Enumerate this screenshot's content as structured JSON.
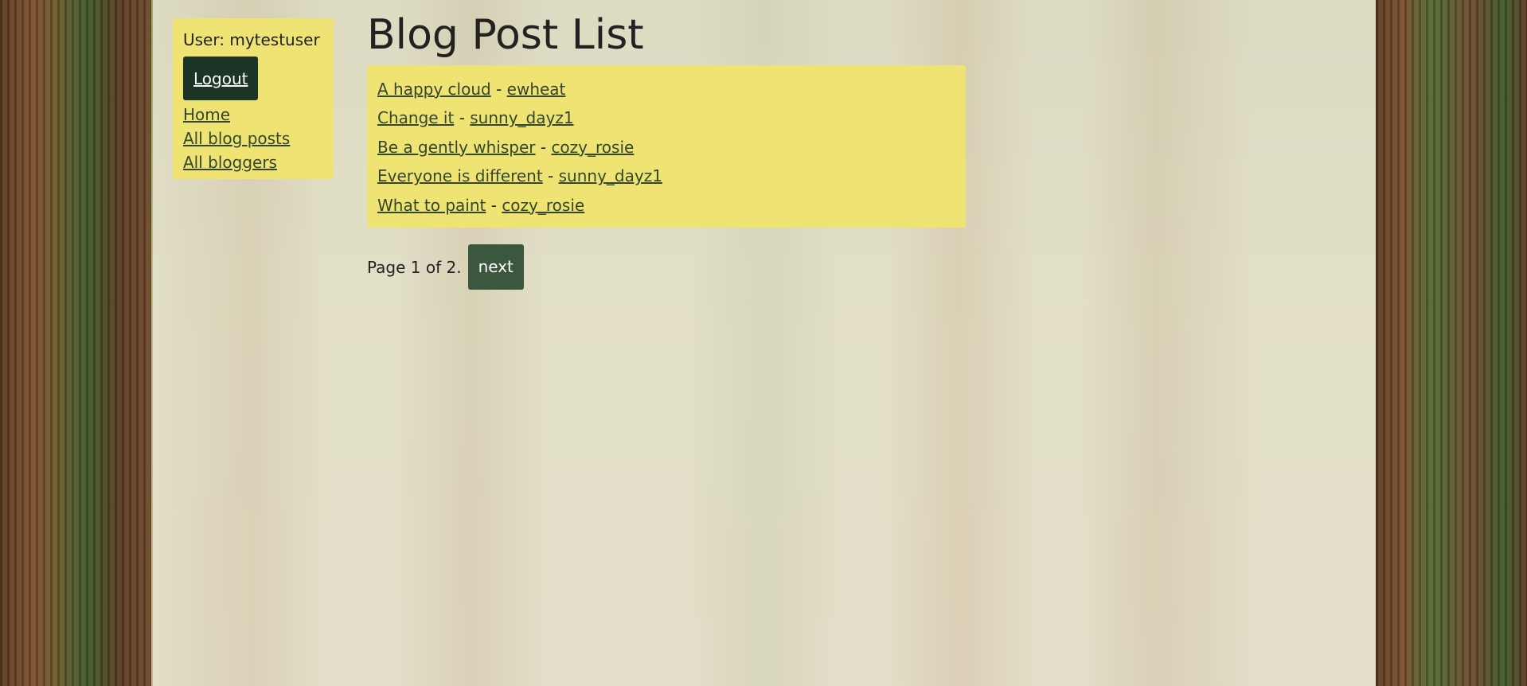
{
  "sidebar": {
    "user_label": "User: mytestuser",
    "logout_label": "Logout",
    "nav": [
      {
        "label": "Home"
      },
      {
        "label": "All blog posts"
      },
      {
        "label": "All bloggers"
      }
    ]
  },
  "main": {
    "title": "Blog Post List",
    "posts": [
      {
        "title": "A happy cloud",
        "separator": "-",
        "author": "ewheat"
      },
      {
        "title": "Change it",
        "separator": "-",
        "author": "sunny_dayz1"
      },
      {
        "title": "Be a gently whisper",
        "separator": "-",
        "author": "cozy_rosie"
      },
      {
        "title": "Everyone is different",
        "separator": "-",
        "author": "sunny_dayz1"
      },
      {
        "title": "What to paint",
        "separator": "-",
        "author": "cozy_rosie"
      }
    ],
    "pagination": {
      "status": "Page 1 of 2.",
      "next_label": "next"
    }
  },
  "colors": {
    "sidebar_bg": "#efe374",
    "logout_bg": "#1c3526",
    "next_bg": "#3b5740",
    "link": "#33472f"
  }
}
